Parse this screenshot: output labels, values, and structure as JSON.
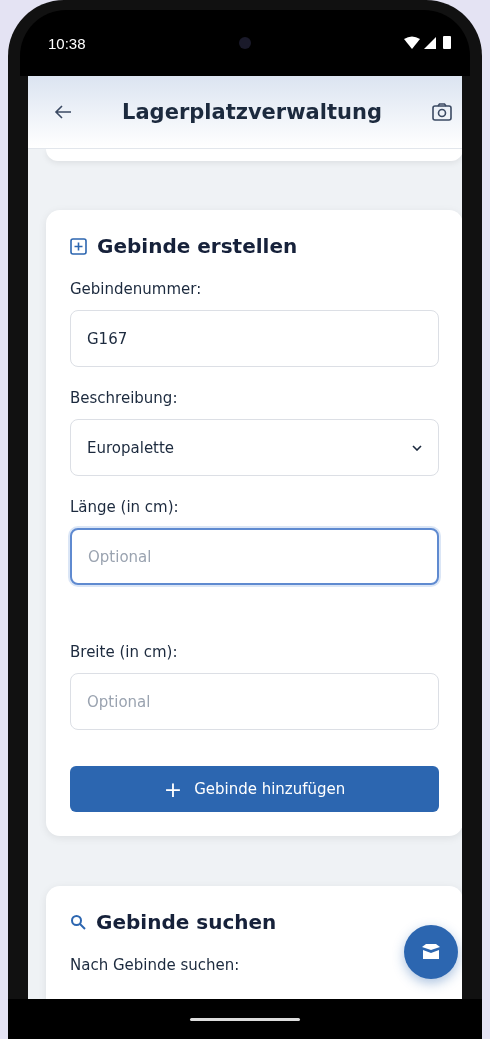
{
  "status_bar": {
    "time": "10:38"
  },
  "header": {
    "title": "Lagerplatzverwaltung"
  },
  "create_card": {
    "title": "Gebinde erstellen",
    "fields": [
      {
        "kind": "input",
        "label": "Gebindenummer:",
        "value": "G167",
        "focused": false
      },
      {
        "kind": "select",
        "label": "Beschreibung:",
        "value": "Europalette",
        "focused": false
      },
      {
        "kind": "input",
        "label": "Länge (in cm):",
        "placeholder": "Optional",
        "focused": true
      },
      {
        "kind": "input",
        "label": "Breite (in cm):",
        "placeholder": "Optional",
        "focused": false
      }
    ],
    "button": {
      "icon": "+",
      "label": "Gebinde hinzufügen"
    }
  },
  "search_card": {
    "title": "Gebinde suchen",
    "label": "Nach Gebinde suchen:"
  }
}
